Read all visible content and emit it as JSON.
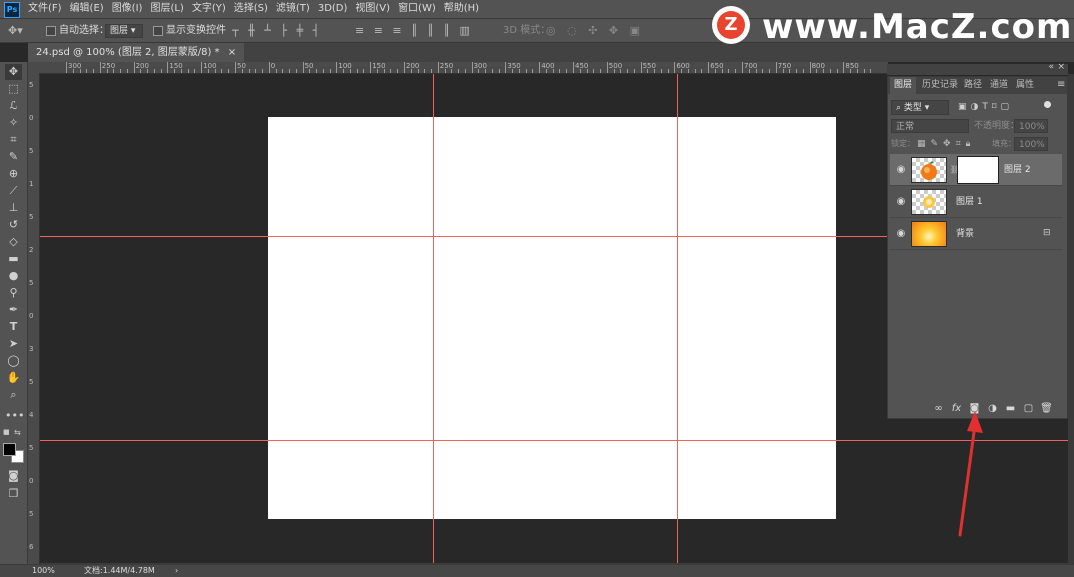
{
  "menubar": {
    "logo": "Ps",
    "items": [
      "文件(F)",
      "编辑(E)",
      "图像(I)",
      "图层(L)",
      "文字(Y)",
      "选择(S)",
      "滤镜(T)",
      "3D(D)",
      "视图(V)",
      "窗口(W)",
      "帮助(H)"
    ]
  },
  "options_bar": {
    "auto_select_label": "自动选择：",
    "auto_select_value": "图层",
    "show_transform_label": "显示变换控件",
    "mode_3d_label": "3D 模式："
  },
  "document_tab": {
    "title": "24.psd @ 100% (图层 2, 图层蒙版/8) *",
    "close": "×"
  },
  "ruler": {
    "h_labels": [
      "300",
      "250",
      "200",
      "150",
      "100",
      "50",
      "0",
      "50",
      "100",
      "150",
      "200",
      "250",
      "300",
      "350",
      "400",
      "450",
      "500",
      "550",
      "600",
      "650",
      "700",
      "750",
      "800",
      "850"
    ],
    "v_labels": [
      "5",
      "0",
      "5",
      "1",
      "5",
      "2",
      "5",
      "0",
      "3",
      "5",
      "4",
      "5",
      "0",
      "5",
      "6"
    ]
  },
  "layers_panel": {
    "tabs": [
      "图层",
      "历史记录",
      "路径",
      "通道",
      "属性"
    ],
    "filter_label": "类型",
    "blend_mode": "正常",
    "opacity_label": "不透明度：",
    "opacity_value": "100%",
    "lock_label": "锁定：",
    "fill_label": "填充：",
    "fill_value": "100%",
    "layers": [
      {
        "name": "图层 2",
        "selected": true,
        "has_mask": true
      },
      {
        "name": "图层 1",
        "selected": false,
        "has_mask": false
      },
      {
        "name": "背景",
        "selected": false,
        "locked": true
      }
    ]
  },
  "status_bar": {
    "zoom": "100%",
    "doc_info": "文档:1.44M/4.78M",
    "arrow": "›"
  },
  "watermark": {
    "logo_letter": "Z",
    "text": "www.MacZ.com"
  },
  "colors": {
    "guide": "#f06060",
    "arrow": "#e03030",
    "ui_panel": "#535353",
    "canvas_bg": "#282828"
  }
}
